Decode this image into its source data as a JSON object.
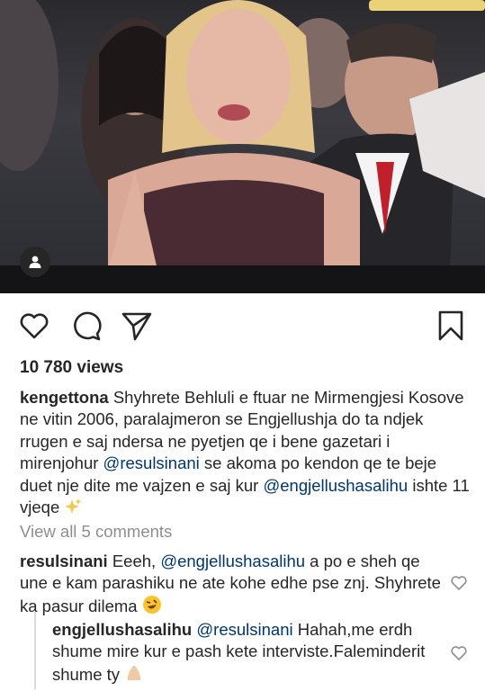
{
  "post": {
    "views": "10 780 views",
    "caption": {
      "username": "kengettona",
      "text_1": " Shyhrete Behluli e ftuar ne Mirmengjesi Kosove ne vitin 2006, paralajmeron se Engjellushja do ta ndjek rrugen e saj ndersa ne pyetjen qe i bene gazetari i mirenjohur ",
      "mention_1": "@resulsinani",
      "text_2": " se akoma po kendon qe te beje duet nje dite me vajzen e saj kur ",
      "mention_2": "@engjellushasalihu",
      "text_3": " ishte 11 vjeqe"
    },
    "view_all_comments": "View all 5 comments"
  },
  "comments": [
    {
      "username": "resulsinani",
      "text_1": " Eeeh, ",
      "mention": "@engjellushasalihu",
      "text_2": " a po e sheh qe une e kam parashiku ne ate kohe edhe pse znj. Shyhrete ka pasur dilema"
    }
  ],
  "reply": {
    "username": "engjellushasalihu",
    "mention": "@resulsinani",
    "text": "  Hahah,me erdh shume mire kur e pash kete interviste.Faleminderit shume ty"
  },
  "icons": {
    "like": "heart-icon",
    "comment": "comment-bubble-icon",
    "share": "paper-plane-icon",
    "save": "bookmark-icon",
    "tag": "user-icon"
  },
  "colors": {
    "text": "#262626",
    "mention": "#00376b",
    "muted": "#8e8e8e"
  }
}
